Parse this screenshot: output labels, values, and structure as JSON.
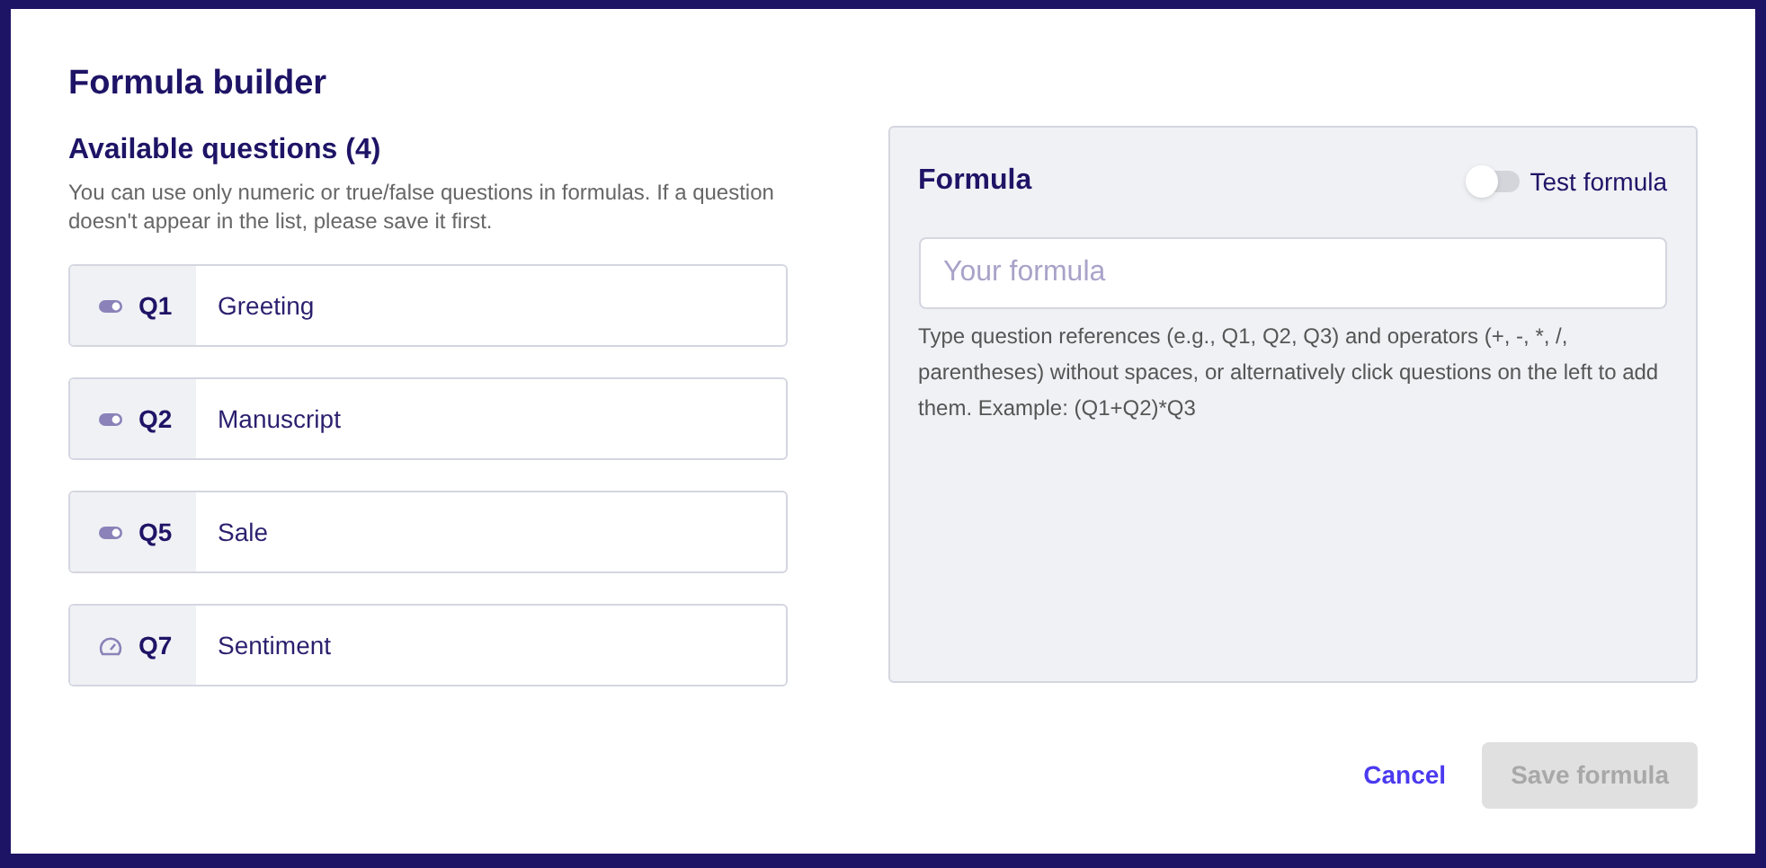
{
  "dialog": {
    "title": "Formula builder"
  },
  "questions_panel": {
    "heading": "Available questions (4)",
    "help": "You can use only numeric or true/false questions in formulas. If a question doesn't appear in the list, please save it first."
  },
  "questions": [
    {
      "kind": "boolean",
      "id_label": "Q1",
      "label": "Greeting"
    },
    {
      "kind": "boolean",
      "id_label": "Q2",
      "label": "Manuscript"
    },
    {
      "kind": "boolean",
      "id_label": "Q5",
      "label": "Sale"
    },
    {
      "kind": "numeric",
      "id_label": "Q7",
      "label": "Sentiment"
    }
  ],
  "formula_panel": {
    "heading": "Formula",
    "test_toggle": {
      "label": "Test formula",
      "on": false
    },
    "input": {
      "placeholder": "Your formula"
    },
    "hint": "Type question references (e.g., Q1, Q2, Q3) and operators (+, -, *, /, parentheses) without spaces, or alternatively click questions on the left to add them. Example: (Q1+Q2)*Q3"
  },
  "buttons": {
    "cancel": "Cancel",
    "save": {
      "label": "Save formula",
      "disabled": true
    }
  }
}
